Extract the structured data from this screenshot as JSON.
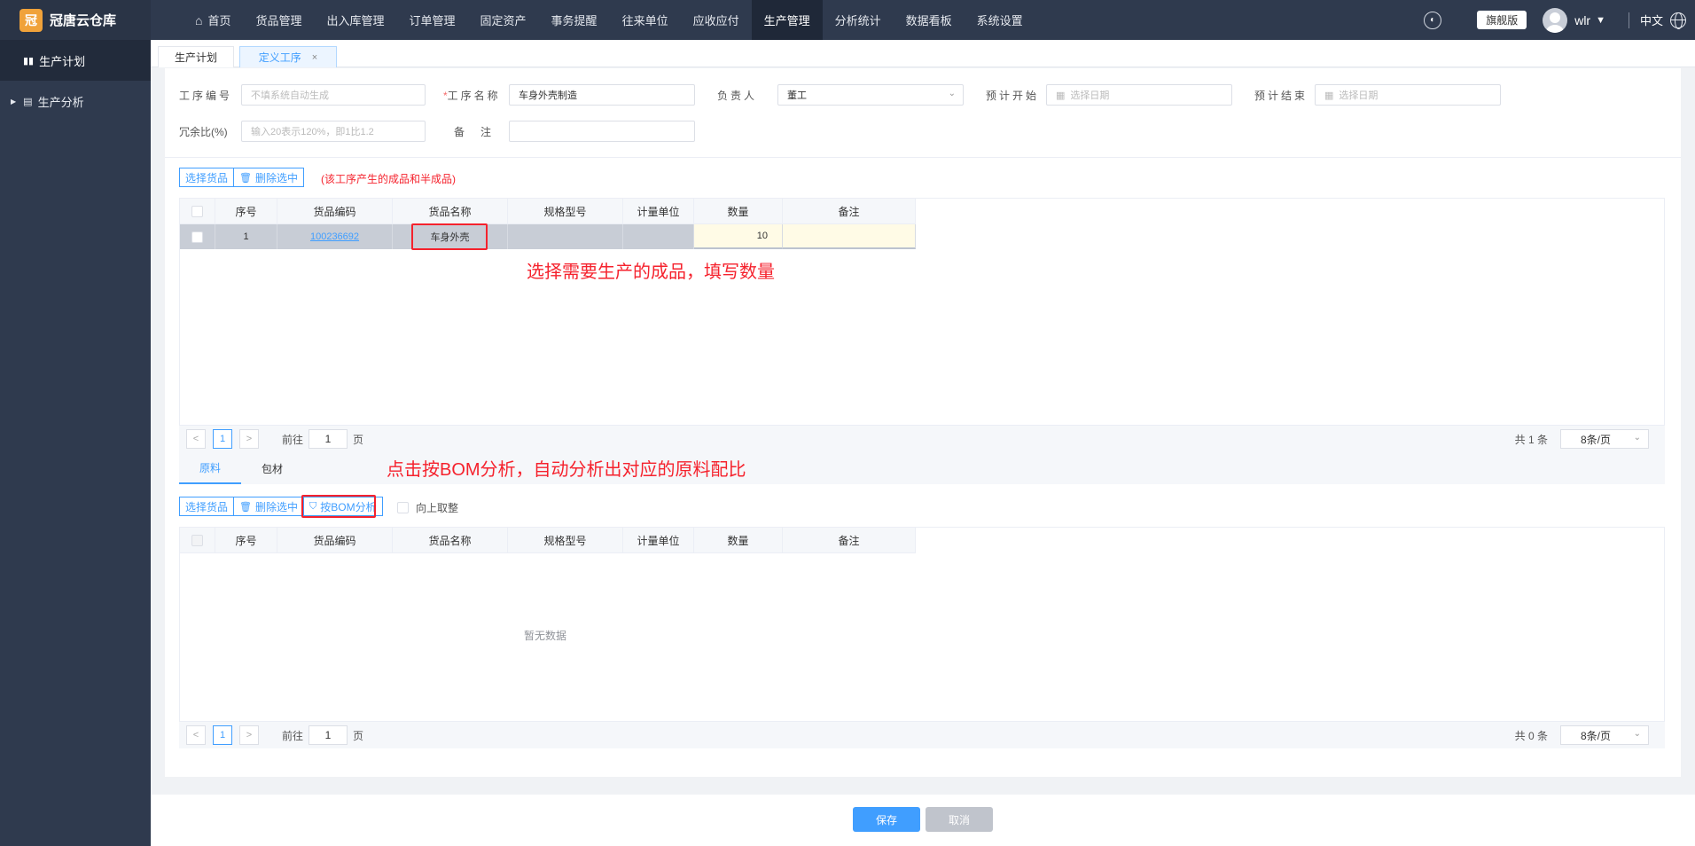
{
  "app": {
    "name": "冠唐云仓库",
    "logo_glyph": "冠"
  },
  "topnav": {
    "home_label": "首页",
    "items": [
      "货品管理",
      "出入库管理",
      "订单管理",
      "固定资产",
      "事务提醒",
      "往来单位",
      "应收应付",
      "生产管理",
      "分析统计",
      "数据看板",
      "系统设置"
    ],
    "active": "生产管理",
    "edition": "旗舰版",
    "user": "wlr",
    "language": "中文"
  },
  "sidebar": {
    "items": [
      {
        "label": "生产计划",
        "icon": "bar-chart-icon"
      },
      {
        "label": "生产分析",
        "icon": "document-icon"
      }
    ]
  },
  "tabs": [
    {
      "label": "生产计划"
    },
    {
      "label": "定义工序",
      "close": "×"
    }
  ],
  "form": {
    "code_label": "工序编号",
    "code_placeholder": "不填系统自动生成",
    "name_label": "工序名称",
    "name_required": "*",
    "name_value": "车身外壳制造",
    "owner_label": "负责人",
    "owner_value": "董工",
    "start_label": "预计开始",
    "start_placeholder": "选择日期",
    "end_label": "预计结束",
    "end_placeholder": "选择日期",
    "ratio_label": "冗余比(%)",
    "ratio_placeholder": "输入20表示120%，即1比1.2",
    "note_label": "备注",
    "note_value": ""
  },
  "products": {
    "select_btn": "选择货品",
    "delete_btn": "删除选中",
    "hint": "(该工序产生的成品和半成品)",
    "columns": [
      "序号",
      "货品编码",
      "货品名称",
      "规格型号",
      "计量单位",
      "数量",
      "备注"
    ],
    "rows": [
      {
        "seq": "1",
        "code": "100236692",
        "name": "车身外壳",
        "spec": "",
        "unit": "",
        "qty": "10",
        "note": ""
      }
    ],
    "annotation": "选择需要生产的成品，填写数量",
    "pager": {
      "prev": "<",
      "page": "1",
      "next": ">",
      "goto_prefix": "前往",
      "goto_value": "1",
      "goto_suffix": "页",
      "total": "共 1 条",
      "page_size": "8条/页"
    }
  },
  "materials": {
    "subtabs": [
      "原料",
      "包材"
    ],
    "active_subtab": "原料",
    "select_btn": "选择货品",
    "delete_btn": "删除选中",
    "bom_btn": "按BOM分析",
    "roundup_label": "向上取整",
    "annotation": "点击按BOM分析，自动分析出对应的原料配比",
    "columns": [
      "序号",
      "货品编码",
      "货品名称",
      "规格型号",
      "计量单位",
      "数量",
      "备注"
    ],
    "empty_text": "暂无数据",
    "pager": {
      "prev": "<",
      "page": "1",
      "next": ">",
      "goto_prefix": "前往",
      "goto_value": "1",
      "goto_suffix": "页",
      "total": "共 0 条",
      "page_size": "8条/页"
    }
  },
  "footer": {
    "save": "保存",
    "cancel": "取消"
  },
  "colors": {
    "primary": "#409eff",
    "nav_bg": "#2f3a4e",
    "annotation": "#f5222d",
    "highlight_row": "#c8cdd6"
  }
}
